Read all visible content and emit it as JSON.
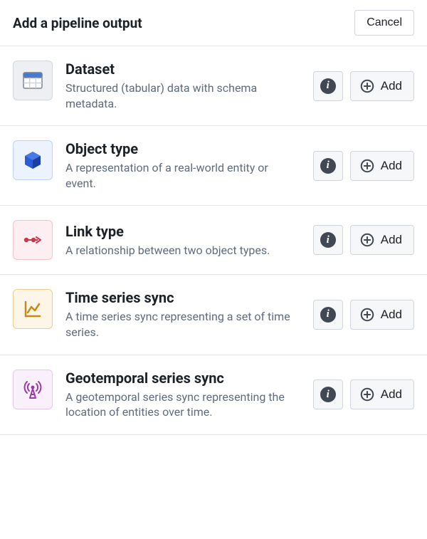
{
  "header": {
    "title": "Add a pipeline output",
    "cancel_label": "Cancel"
  },
  "common": {
    "add_label": "Add",
    "info_label": "i"
  },
  "items": [
    {
      "title": "Dataset",
      "description": "Structured (tabular) data with schema metadata.",
      "icon": "dataset-icon",
      "theme": "dataset"
    },
    {
      "title": "Object type",
      "description": "A representation of a real-world entity or event.",
      "icon": "cube-icon",
      "theme": "object"
    },
    {
      "title": "Link type",
      "description": "A relationship between two object types.",
      "icon": "link-icon",
      "theme": "link"
    },
    {
      "title": "Time series sync",
      "description": "A time series sync representing a set of time series.",
      "icon": "chart-line-icon",
      "theme": "time"
    },
    {
      "title": "Geotemporal series sync",
      "description": "A geotemporal series sync representing the location of entities over time.",
      "icon": "antenna-icon",
      "theme": "geo"
    }
  ]
}
